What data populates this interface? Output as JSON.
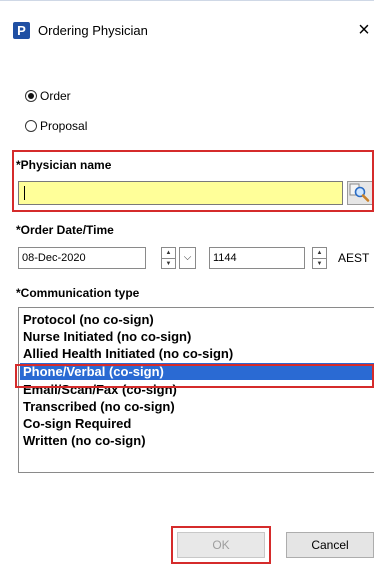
{
  "window": {
    "title": "Ordering Physician",
    "app_icon_letter": "P",
    "close_glyph": "×"
  },
  "order_mode": {
    "options": [
      {
        "label": "Order",
        "selected": true
      },
      {
        "label": "Proposal",
        "selected": false
      }
    ]
  },
  "physician": {
    "label": "*Physician name",
    "value": "",
    "lookup_icon": "magnifier-icon"
  },
  "order_datetime": {
    "label": "*Order Date/Time",
    "date": "08-Dec-2020",
    "time": "1144",
    "timezone": "AEST"
  },
  "communication": {
    "label": "*Communication type",
    "items": [
      "Protocol (no co-sign)",
      "Nurse Initiated (no co-sign)",
      "Allied Health Initiated (no co-sign)",
      "Phone/Verbal (co-sign)",
      "Email/Scan/Fax (co-sign)",
      "Transcribed (no co-sign)",
      "Co-sign Required",
      "Written (no co-sign)"
    ],
    "selected_index": 3
  },
  "buttons": {
    "ok": "OK",
    "cancel": "Cancel"
  },
  "colors": {
    "highlight_border": "#d52b2b",
    "input_background": "#ffff99",
    "selection_background": "#2a6ad3"
  }
}
